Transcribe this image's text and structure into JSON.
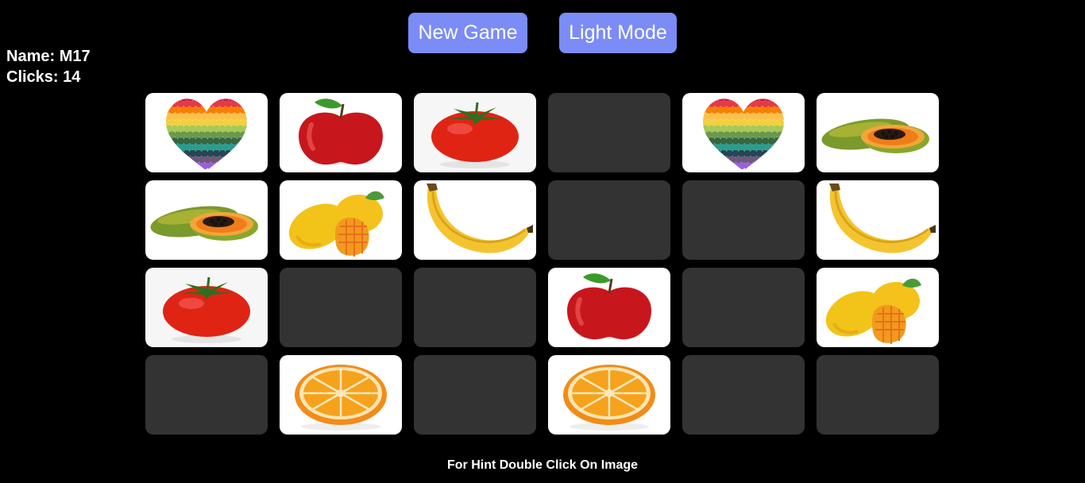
{
  "header": {
    "new_game_label": "New Game",
    "light_mode_label": "Light Mode"
  },
  "player": {
    "name_text": "Name: M17",
    "clicks_text": "Clicks: 14",
    "clicks": 14
  },
  "board": {
    "columns": 6,
    "rows": 4,
    "cards": [
      {
        "fruit": "heart",
        "revealed": true
      },
      {
        "fruit": "apple",
        "revealed": true
      },
      {
        "fruit": "tomato",
        "revealed": true
      },
      {
        "fruit": null,
        "revealed": false
      },
      {
        "fruit": "heart",
        "revealed": true
      },
      {
        "fruit": "papaya",
        "revealed": true
      },
      {
        "fruit": "papaya",
        "revealed": true
      },
      {
        "fruit": "mango",
        "revealed": true
      },
      {
        "fruit": "banana",
        "revealed": true
      },
      {
        "fruit": null,
        "revealed": false
      },
      {
        "fruit": null,
        "revealed": false
      },
      {
        "fruit": "banana",
        "revealed": true
      },
      {
        "fruit": "tomato",
        "revealed": true
      },
      {
        "fruit": null,
        "revealed": false
      },
      {
        "fruit": null,
        "revealed": false
      },
      {
        "fruit": "apple",
        "revealed": true
      },
      {
        "fruit": null,
        "revealed": false
      },
      {
        "fruit": "mango",
        "revealed": true
      },
      {
        "fruit": null,
        "revealed": false
      },
      {
        "fruit": "orange",
        "revealed": true
      },
      {
        "fruit": null,
        "revealed": false
      },
      {
        "fruit": "orange",
        "revealed": true
      },
      {
        "fruit": null,
        "revealed": false
      },
      {
        "fruit": null,
        "revealed": false
      }
    ]
  },
  "footer": {
    "hint_text": "For Hint Double Click On Image"
  },
  "colors": {
    "background": "#000000",
    "button": "#7b8cf7",
    "hidden_card": "#333333",
    "revealed_card": "#ffffff"
  }
}
